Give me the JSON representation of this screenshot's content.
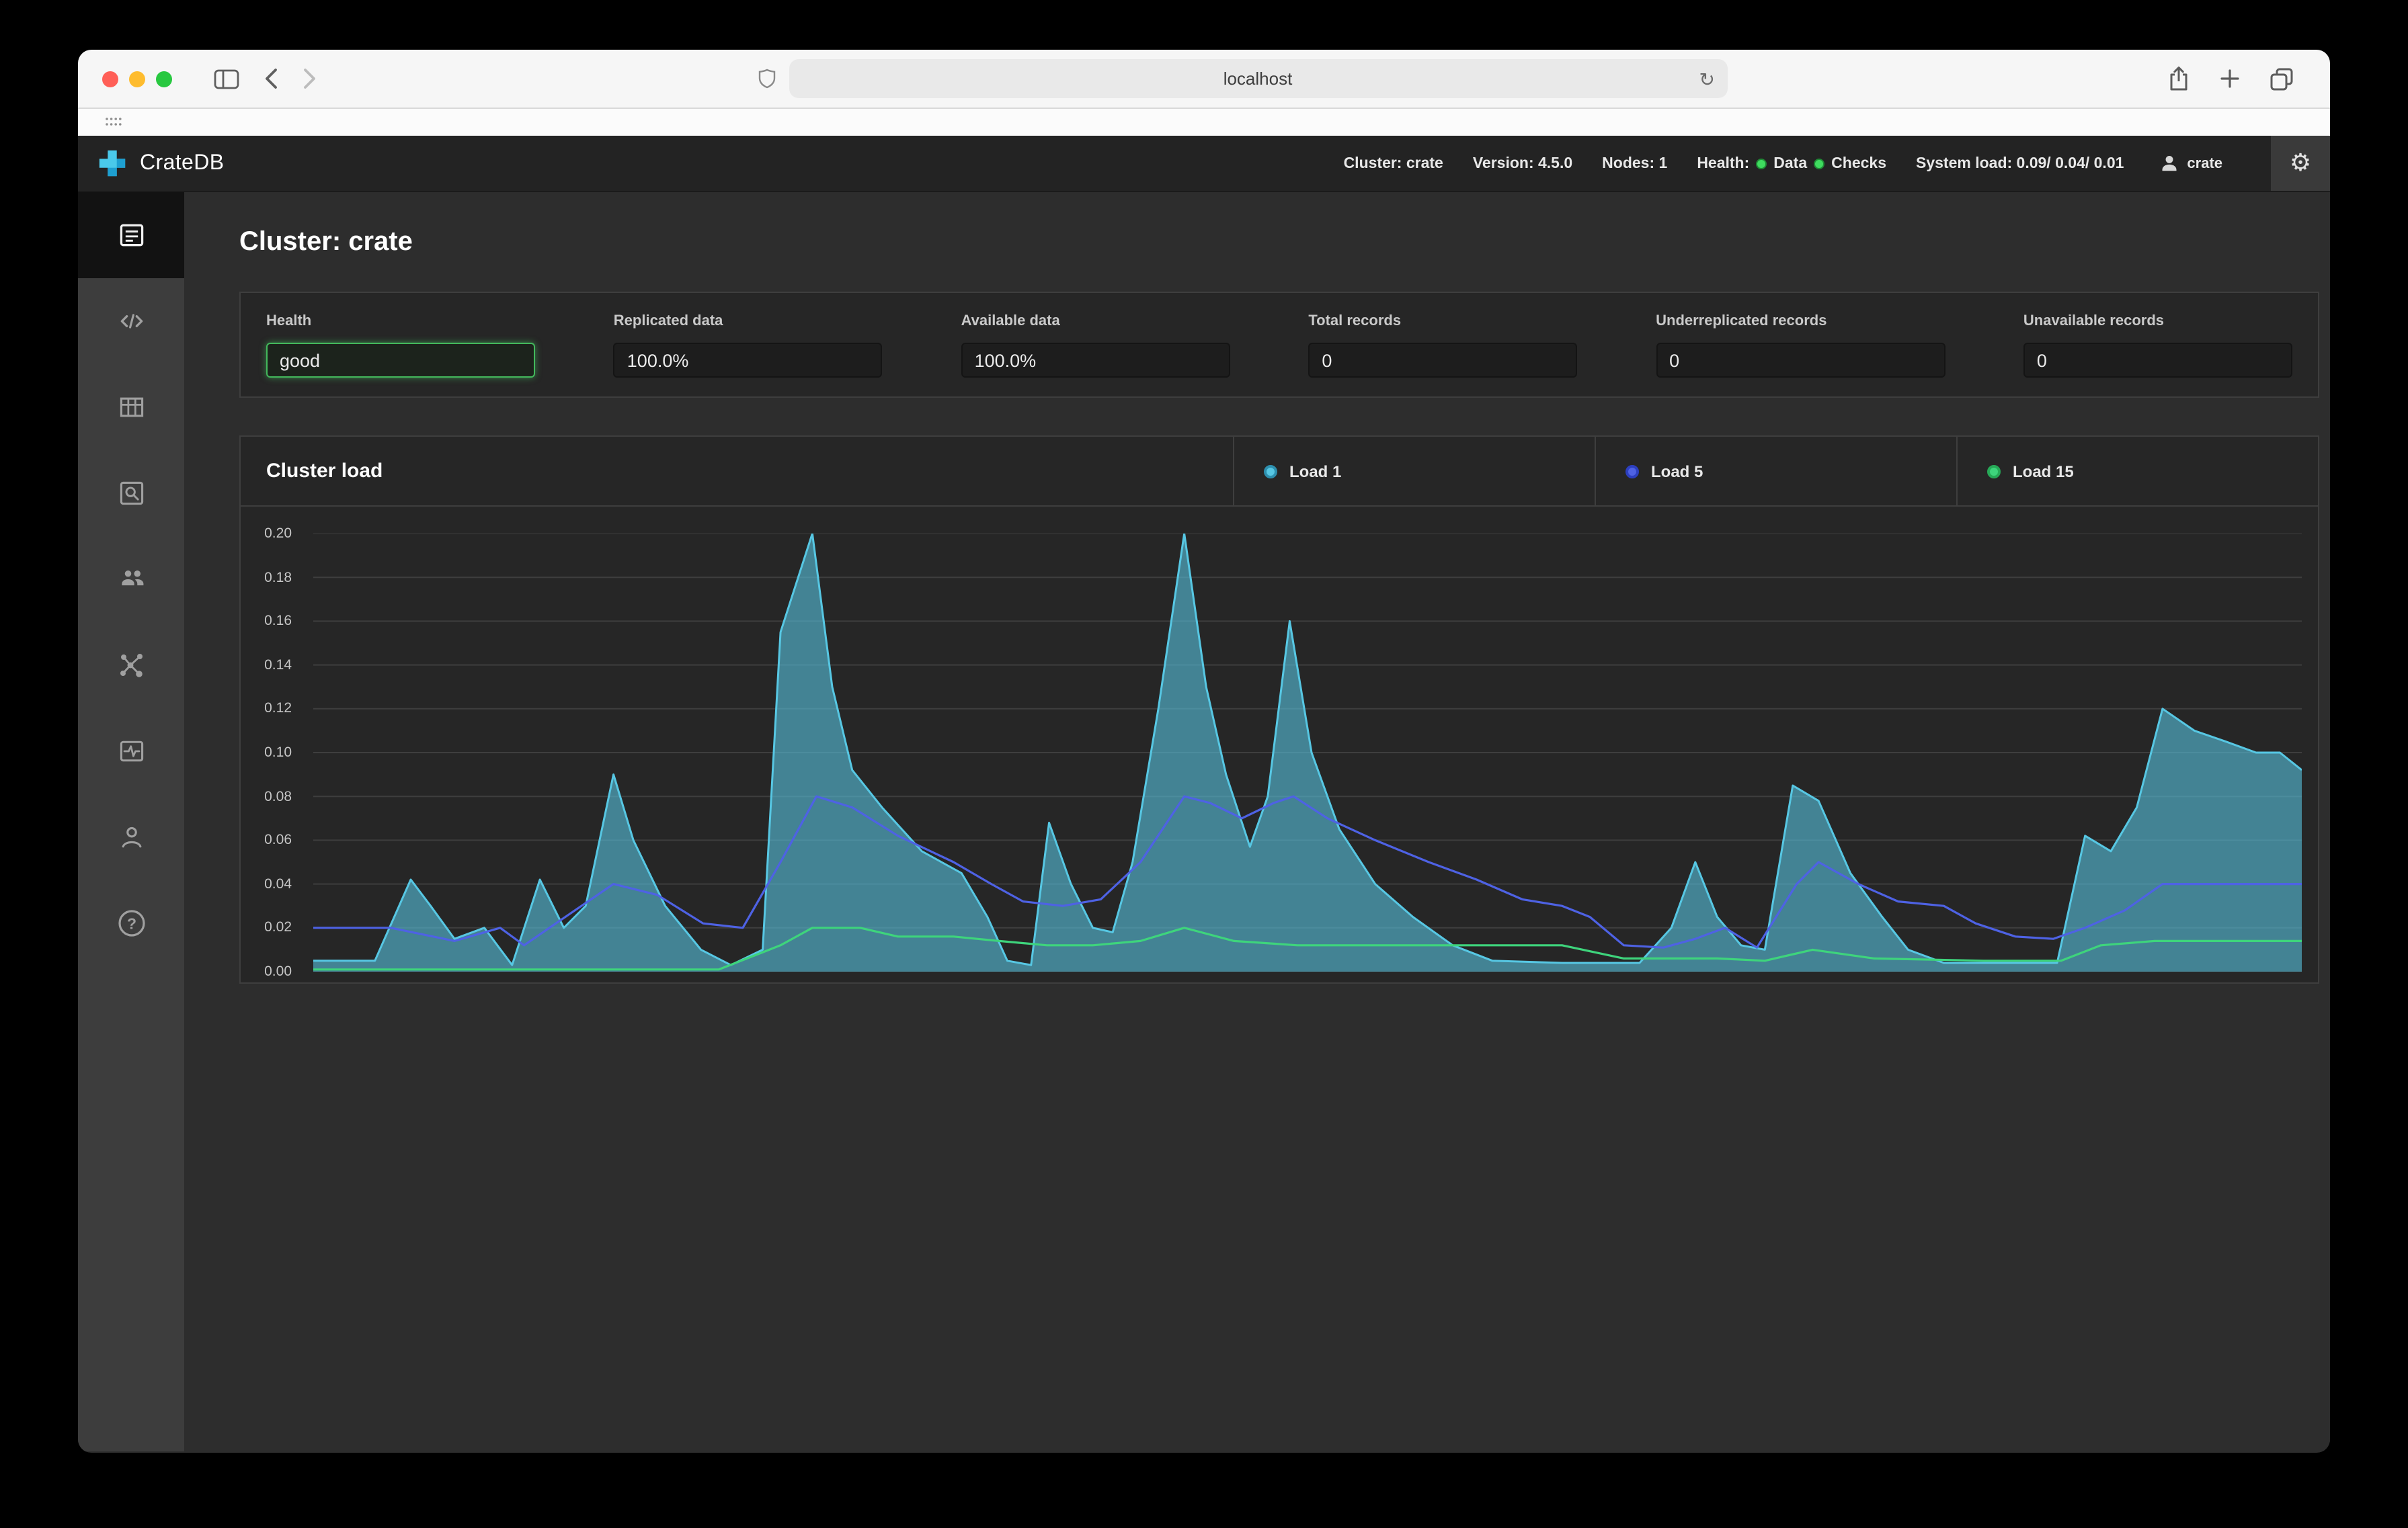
{
  "colors": {
    "health_border": "#43b85c",
    "navbar_dot": "#3fdc5f",
    "brand_light": "#4ac9ea",
    "brand_dark": "#1e9fd0"
  },
  "browser": {
    "url": "localhost",
    "traffic_lights": [
      "#ff5f57",
      "#febc2e",
      "#28c840"
    ]
  },
  "navbar": {
    "brand": "CrateDB",
    "cluster": "Cluster: crate",
    "version": "Version: 4.5.0",
    "nodes": "Nodes: 1",
    "health_label": "Health:",
    "health_data": "Data",
    "health_checks": "Checks",
    "system_load": "System load: 0.09/ 0.04/ 0.01",
    "user": "crate"
  },
  "main": {
    "title": "Cluster: crate",
    "stats": [
      {
        "label": "Health",
        "value": "good"
      },
      {
        "label": "Replicated data",
        "value": "100.0%"
      },
      {
        "label": "Available data",
        "value": "100.0%"
      },
      {
        "label": "Total records",
        "value": "0"
      },
      {
        "label": "Underreplicated records",
        "value": "0"
      },
      {
        "label": "Unavailable records",
        "value": "0"
      }
    ],
    "load_panel_title": "Cluster load",
    "legend": [
      {
        "label": "Load 1",
        "color": "#57c7e3",
        "ring": "#2d8fae"
      },
      {
        "label": "Load 5",
        "color": "#4e62e4",
        "ring": "#2c3fbf"
      },
      {
        "label": "Load 15",
        "color": "#3ed47c",
        "ring": "#26a957"
      }
    ]
  },
  "chart_data": {
    "type": "area",
    "title": "Cluster load",
    "xlabel": "",
    "ylabel": "",
    "xlim": [
      0,
      100
    ],
    "ylim": [
      0,
      0.2
    ],
    "yticks": [
      "0.20",
      "0.18",
      "0.16",
      "0.14",
      "0.12",
      "0.10",
      "0.08",
      "0.06",
      "0.04",
      "0.02",
      "0.00"
    ],
    "grid": true,
    "grid_color": "#3e3e3e",
    "legend_position": "top-right",
    "series": [
      {
        "name": "Load 1",
        "type": "area",
        "color": "#57c7e3",
        "fill": "rgba(86,189,216,0.62)",
        "points": [
          [
            0,
            0.005
          ],
          [
            3.1,
            0.005
          ],
          [
            4.9,
            0.042
          ],
          [
            5.9,
            0.03
          ],
          [
            7.1,
            0.015
          ],
          [
            8.6,
            0.02
          ],
          [
            10,
            0.003
          ],
          [
            11.4,
            0.042
          ],
          [
            12.6,
            0.02
          ],
          [
            13.7,
            0.03
          ],
          [
            15.1,
            0.09
          ],
          [
            16.1,
            0.06
          ],
          [
            17.7,
            0.03
          ],
          [
            19.5,
            0.01
          ],
          [
            21,
            0.003
          ],
          [
            22.6,
            0.01
          ],
          [
            23.5,
            0.155
          ],
          [
            25.1,
            0.2
          ],
          [
            26.1,
            0.13
          ],
          [
            27.1,
            0.092
          ],
          [
            28.6,
            0.075
          ],
          [
            30.6,
            0.055
          ],
          [
            32.6,
            0.045
          ],
          [
            33.9,
            0.025
          ],
          [
            34.9,
            0.005
          ],
          [
            36.1,
            0.003
          ],
          [
            37,
            0.068
          ],
          [
            38.1,
            0.04
          ],
          [
            39.2,
            0.02
          ],
          [
            40.2,
            0.018
          ],
          [
            41.2,
            0.05
          ],
          [
            42.5,
            0.12
          ],
          [
            43.8,
            0.2
          ],
          [
            44.9,
            0.13
          ],
          [
            45.9,
            0.09
          ],
          [
            47.1,
            0.057
          ],
          [
            48,
            0.08
          ],
          [
            49.1,
            0.16
          ],
          [
            50.2,
            0.1
          ],
          [
            51.6,
            0.065
          ],
          [
            53.4,
            0.04
          ],
          [
            55.3,
            0.025
          ],
          [
            57.3,
            0.012
          ],
          [
            59.3,
            0.005
          ],
          [
            62.8,
            0.004
          ],
          [
            66.7,
            0.004
          ],
          [
            68.3,
            0.02
          ],
          [
            69.5,
            0.05
          ],
          [
            70.6,
            0.025
          ],
          [
            71.8,
            0.012
          ],
          [
            73,
            0.01
          ],
          [
            74.4,
            0.085
          ],
          [
            75.7,
            0.078
          ],
          [
            77.3,
            0.045
          ],
          [
            78.9,
            0.025
          ],
          [
            80.2,
            0.01
          ],
          [
            82,
            0.004
          ],
          [
            85.6,
            0.004
          ],
          [
            87.7,
            0.004
          ],
          [
            89.1,
            0.062
          ],
          [
            90.4,
            0.055
          ],
          [
            91.7,
            0.075
          ],
          [
            93,
            0.12
          ],
          [
            94.6,
            0.11
          ],
          [
            96.2,
            0.105
          ],
          [
            97.7,
            0.1
          ],
          [
            98.9,
            0.1
          ],
          [
            100,
            0.092
          ]
        ]
      },
      {
        "name": "Load 5",
        "type": "line",
        "color": "#4e62e4",
        "points": [
          [
            0,
            0.02
          ],
          [
            3.9,
            0.02
          ],
          [
            7.1,
            0.014
          ],
          [
            9.4,
            0.02
          ],
          [
            10.6,
            0.012
          ],
          [
            12.2,
            0.022
          ],
          [
            15.1,
            0.04
          ],
          [
            17.3,
            0.035
          ],
          [
            19.6,
            0.022
          ],
          [
            21.6,
            0.02
          ],
          [
            23.5,
            0.05
          ],
          [
            25.3,
            0.08
          ],
          [
            27.1,
            0.075
          ],
          [
            29.4,
            0.062
          ],
          [
            32.2,
            0.05
          ],
          [
            34.1,
            0.04
          ],
          [
            35.7,
            0.032
          ],
          [
            37.7,
            0.03
          ],
          [
            39.6,
            0.033
          ],
          [
            41.6,
            0.05
          ],
          [
            43.8,
            0.08
          ],
          [
            45.1,
            0.077
          ],
          [
            46.7,
            0.07
          ],
          [
            48.3,
            0.077
          ],
          [
            49.3,
            0.08
          ],
          [
            51,
            0.07
          ],
          [
            53.4,
            0.06
          ],
          [
            56.1,
            0.05
          ],
          [
            58.5,
            0.042
          ],
          [
            60.8,
            0.033
          ],
          [
            62.8,
            0.03
          ],
          [
            64.2,
            0.025
          ],
          [
            65.9,
            0.012
          ],
          [
            67.9,
            0.011
          ],
          [
            69.5,
            0.015
          ],
          [
            71,
            0.02
          ],
          [
            72.6,
            0.011
          ],
          [
            74.6,
            0.04
          ],
          [
            75.7,
            0.05
          ],
          [
            77.7,
            0.04
          ],
          [
            79.7,
            0.032
          ],
          [
            82,
            0.03
          ],
          [
            83.6,
            0.022
          ],
          [
            85.6,
            0.016
          ],
          [
            87.5,
            0.015
          ],
          [
            89.1,
            0.02
          ],
          [
            91.1,
            0.028
          ],
          [
            93,
            0.04
          ],
          [
            95.8,
            0.04
          ],
          [
            100,
            0.04
          ]
        ]
      },
      {
        "name": "Load 15",
        "type": "line",
        "color": "#3ed47c",
        "points": [
          [
            0,
            0.001
          ],
          [
            20.4,
            0.001
          ],
          [
            23.5,
            0.012
          ],
          [
            25.1,
            0.02
          ],
          [
            27.5,
            0.02
          ],
          [
            29.4,
            0.016
          ],
          [
            32.2,
            0.016
          ],
          [
            34.5,
            0.014
          ],
          [
            36.9,
            0.012
          ],
          [
            39.2,
            0.012
          ],
          [
            41.6,
            0.014
          ],
          [
            43.8,
            0.02
          ],
          [
            46.3,
            0.014
          ],
          [
            49.5,
            0.012
          ],
          [
            54.9,
            0.012
          ],
          [
            62.8,
            0.012
          ],
          [
            65.9,
            0.006
          ],
          [
            70.6,
            0.006
          ],
          [
            73,
            0.005
          ],
          [
            75.4,
            0.01
          ],
          [
            78.5,
            0.006
          ],
          [
            84,
            0.005
          ],
          [
            87.9,
            0.005
          ],
          [
            89.9,
            0.012
          ],
          [
            92.6,
            0.014
          ],
          [
            95.8,
            0.014
          ],
          [
            100,
            0.014
          ]
        ]
      }
    ]
  }
}
